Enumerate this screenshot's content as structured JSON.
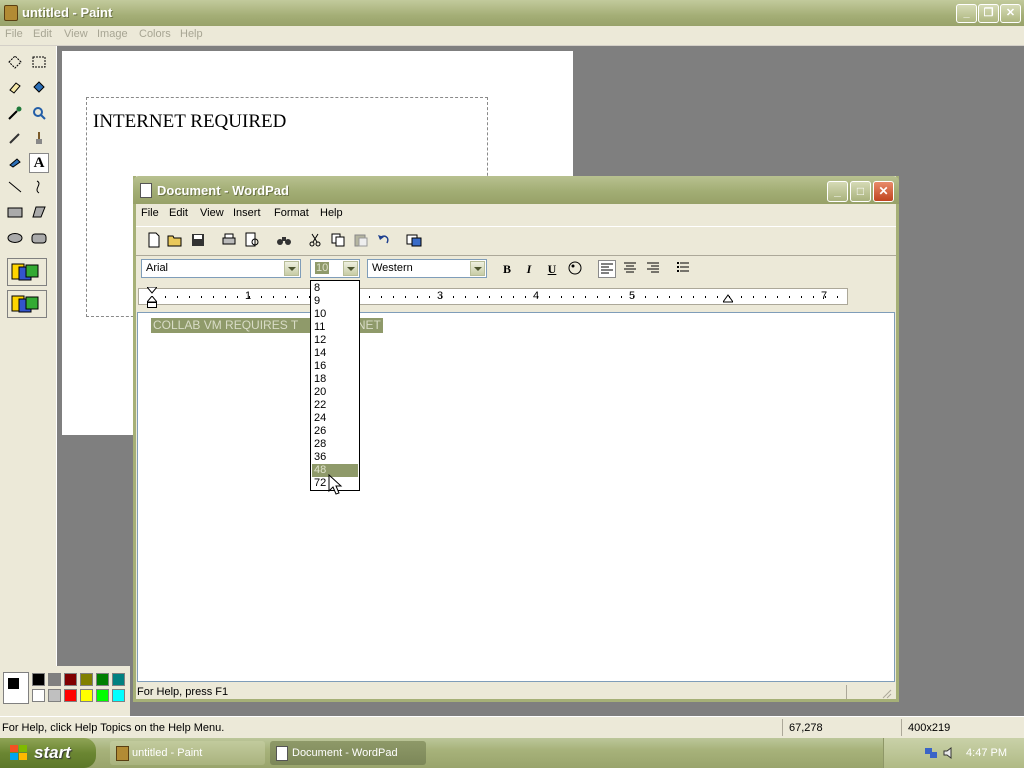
{
  "paint": {
    "title": "untitled - Paint",
    "menu": [
      "File",
      "Edit",
      "View",
      "Image",
      "Colors",
      "Help"
    ],
    "canvas_text": "INTERNET REQUIRED",
    "status": {
      "help": "For Help, click Help Topics on the Help Menu.",
      "coords": "67,278",
      "size": "400x219"
    },
    "palette_colors": [
      "#000000",
      "#808080",
      "#800000",
      "#808000",
      "#008000",
      "#008080",
      "#ffffff",
      "#c0c0c0",
      "#ff0000",
      "#ffff00",
      "#00ff00",
      "#00ffff"
    ]
  },
  "wordpad": {
    "title": "Document - WordPad",
    "menu": [
      "File",
      "Edit",
      "View",
      "Insert",
      "Format",
      "Help"
    ],
    "font_name": "Arial",
    "font_size": "10",
    "script": "Western",
    "bold_label": "B",
    "italic_label": "I",
    "underline_label": "U",
    "ruler_numbers": [
      "1",
      "3",
      "4",
      "5",
      "7"
    ],
    "doc_text": "COLLAB VM REQUIRES T",
    "doc_text_tail": "RNET",
    "status": "For Help, press F1",
    "size_options": [
      "8",
      "9",
      "10",
      "11",
      "12",
      "14",
      "16",
      "18",
      "20",
      "22",
      "24",
      "26",
      "28",
      "36",
      "48",
      "72"
    ],
    "highlighted_size": "48"
  },
  "taskbar": {
    "start": "start",
    "tasks": [
      "untitled - Paint",
      "Document - WordPad"
    ],
    "clock": "4:47 PM"
  },
  "colors": {
    "title_olive": "#a4ae76",
    "highlight": "#8f9a6a",
    "face": "#ece9d8"
  }
}
